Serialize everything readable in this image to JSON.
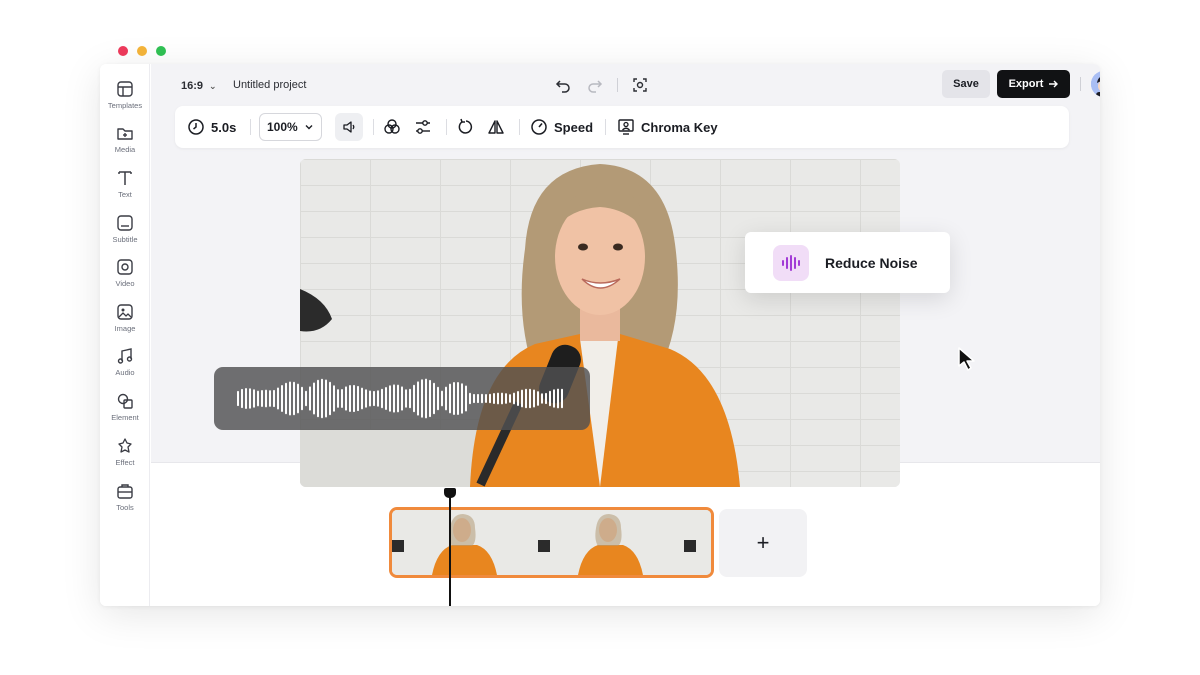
{
  "window": {
    "traffic_colors": [
      "#ee3a5c",
      "#f5b53a",
      "#30c254"
    ]
  },
  "sidebar": {
    "items": [
      {
        "label": "Templates",
        "icon": "templates-icon"
      },
      {
        "label": "Media",
        "icon": "media-icon"
      },
      {
        "label": "Text",
        "icon": "text-icon"
      },
      {
        "label": "Subtitle",
        "icon": "subtitle-icon"
      },
      {
        "label": "Video",
        "icon": "video-icon"
      },
      {
        "label": "Image",
        "icon": "image-icon"
      },
      {
        "label": "Audio",
        "icon": "audio-icon"
      },
      {
        "label": "Element",
        "icon": "element-icon"
      },
      {
        "label": "Effect",
        "icon": "effect-icon"
      },
      {
        "label": "Tools",
        "icon": "tools-icon"
      }
    ]
  },
  "header": {
    "aspect_ratio": "16:9",
    "project_name": "Untitled project",
    "save_label": "Save",
    "export_label": "Export"
  },
  "toolbar": {
    "duration": "5.0s",
    "zoom": "100%",
    "speed_label": "Speed",
    "chroma_label": "Chroma Key"
  },
  "popup": {
    "label": "Reduce Noise",
    "accent": "#a23ad6"
  },
  "timeline": {
    "clip_border": "#f08a3c",
    "add_label": "+"
  }
}
